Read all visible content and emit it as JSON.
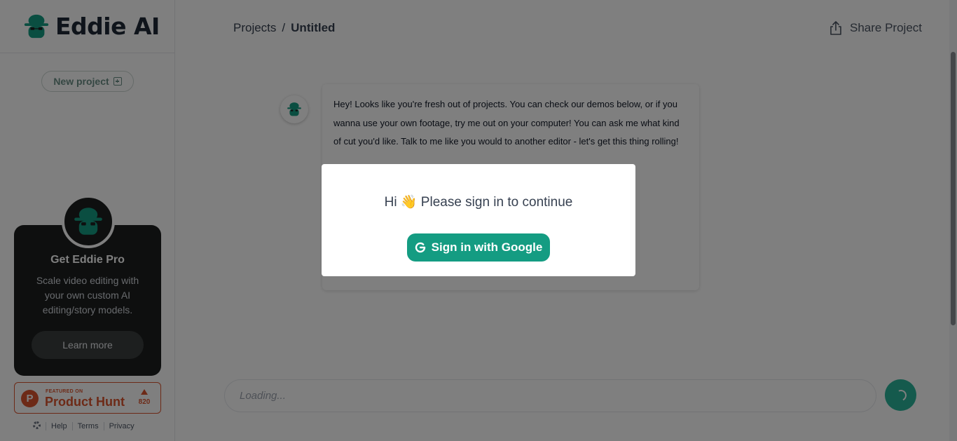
{
  "brand": {
    "name": "Eddie AI"
  },
  "sidebar": {
    "new_project_label": "New project",
    "promo": {
      "title": "Get Eddie Pro",
      "text": "Scale video editing with your own custom AI editing/story models.",
      "button": "Learn more"
    },
    "product_hunt": {
      "featured": "FEATURED ON",
      "name": "Product Hunt",
      "letter": "P",
      "votes": "820"
    },
    "footer": {
      "help": "Help",
      "terms": "Terms",
      "privacy": "Privacy"
    }
  },
  "header": {
    "breadcrumb_root": "Projects",
    "breadcrumb_sep": "/",
    "breadcrumb_current": "Untitled",
    "share_label": "Share Project"
  },
  "chat": {
    "message": "Hey! Looks like you're fresh out of projects. You can check our demos below, or if you wanna use your own footage, try me out on your computer! You can ask me what kind of cut you'd like. Talk to me like you would to another editor - let's get this thing rolling!",
    "input_placeholder": "Loading..."
  },
  "modal": {
    "text": "Hi 👋 Please sign in to continue",
    "button": "Sign in with Google"
  },
  "colors": {
    "accent": "#149c82",
    "product_hunt": "#da552f",
    "promo_bg": "#1c1f1f"
  }
}
